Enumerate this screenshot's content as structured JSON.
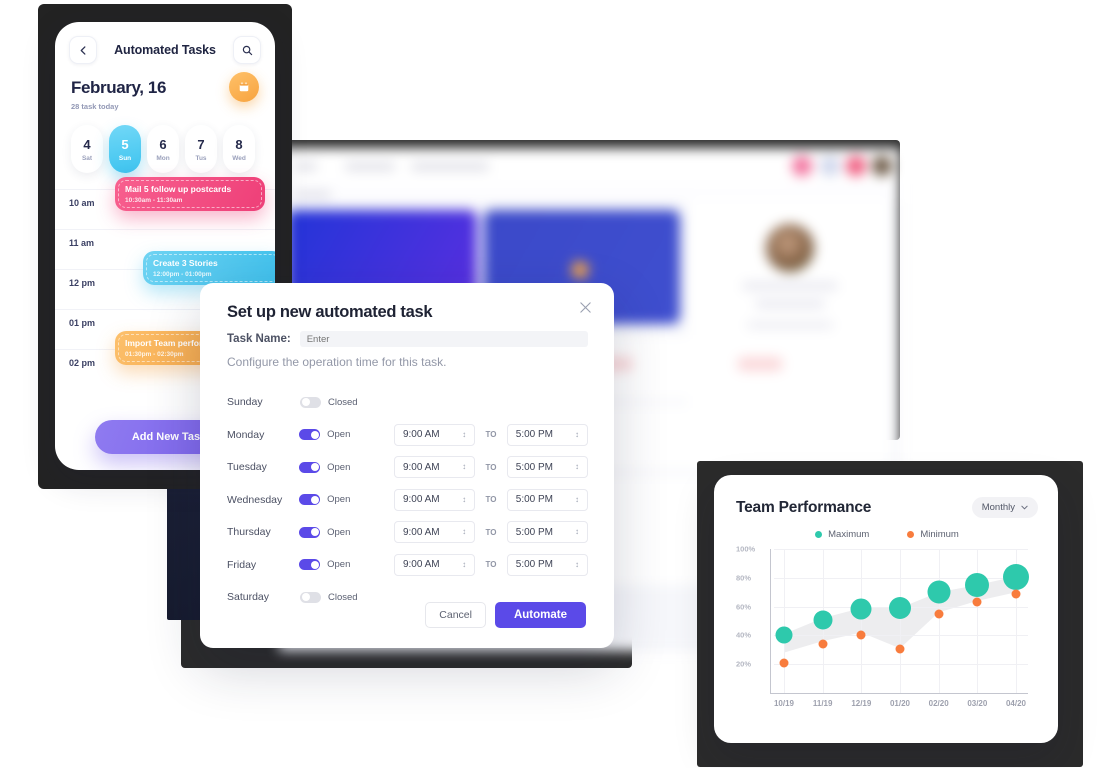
{
  "phone": {
    "back_icon": "chevron-left-icon",
    "title": "Automated Tasks",
    "search_icon": "search-icon",
    "date": "February, 16",
    "subtitle": "28 task today",
    "calendar_icon": "calendar-icon",
    "days": [
      {
        "num": "4",
        "name": "Sat",
        "active": false
      },
      {
        "num": "5",
        "name": "Sun",
        "active": true
      },
      {
        "num": "6",
        "name": "Mon",
        "active": false
      },
      {
        "num": "7",
        "name": "Tus",
        "active": false
      },
      {
        "num": "8",
        "name": "Wed",
        "active": false
      }
    ],
    "slots": [
      "10 am",
      "11 am",
      "12 pm",
      "01 pm",
      "02 pm"
    ],
    "tasks": [
      {
        "title": "Mail 5 follow up postcards",
        "time": "10:30am - 11:30am",
        "color": "#ee3f78"
      },
      {
        "title": "Create 3 Stories",
        "time": "12:00pm - 01:00pm",
        "color": "#3ec0ec"
      },
      {
        "title": "Import Team performance",
        "time": "01:30pm - 02:30pm",
        "color": "#f5a13f"
      }
    ],
    "add_button": "Add New Task"
  },
  "modal": {
    "title": "Set up new automated task",
    "close_icon": "close-icon",
    "task_name_label": "Task Name:",
    "task_name_value": "",
    "task_name_placeholder": "Enter",
    "description": "Configure the operation time for this task.",
    "to_label": "TO",
    "open_label": "Open",
    "closed_label": "Closed",
    "rows": [
      {
        "day": "Sunday",
        "open": false,
        "from": "",
        "to": ""
      },
      {
        "day": "Monday",
        "open": true,
        "from": "9:00 AM",
        "to": "5:00 PM"
      },
      {
        "day": "Tuesday",
        "open": true,
        "from": "9:00 AM",
        "to": "5:00 PM"
      },
      {
        "day": "Wednesday",
        "open": true,
        "from": "9:00 AM",
        "to": "5:00 PM"
      },
      {
        "day": "Thursday",
        "open": true,
        "from": "9:00 AM",
        "to": "5:00 PM"
      },
      {
        "day": "Friday",
        "open": true,
        "from": "9:00 AM",
        "to": "5:00 PM"
      },
      {
        "day": "Saturday",
        "open": false,
        "from": "",
        "to": ""
      }
    ],
    "cancel_label": "Cancel",
    "automate_label": "Automate",
    "accent": "#5b4ae8"
  },
  "chart_panel": {
    "dropdown_label": "Monthly",
    "dropdown_icon": "chevron-down-icon"
  },
  "chart_data": {
    "type": "scatter",
    "title": "Team Performance",
    "xlabel": "",
    "ylabel": "",
    "ylim": [
      0,
      100
    ],
    "yticks": [
      "20%",
      "40%",
      "60%",
      "80%",
      "100%"
    ],
    "grid": true,
    "legend_position": "top-center",
    "categories": [
      "10/19",
      "11/19",
      "12/19",
      "01/20",
      "02/20",
      "03/20",
      "04/20"
    ],
    "series": [
      {
        "name": "Maximum",
        "color": "#2ec9ac",
        "values": [
          40,
          50.5,
          58.5,
          59,
          70,
          75,
          80.5
        ],
        "sizes": [
          17,
          19,
          21,
          22,
          23,
          24,
          26
        ]
      },
      {
        "name": "Minimum",
        "color": "#f87c3d",
        "values": [
          20.5,
          34,
          40.5,
          30.5,
          55,
          63.5,
          69
        ],
        "sizes": [
          9,
          9,
          9,
          9,
          9,
          9,
          9
        ]
      }
    ],
    "band": {
      "color": "#ededef",
      "upper": [
        41,
        52,
        59,
        59,
        70,
        75,
        81
      ],
      "lower": [
        28,
        36,
        42,
        31,
        56,
        64,
        70
      ]
    }
  }
}
